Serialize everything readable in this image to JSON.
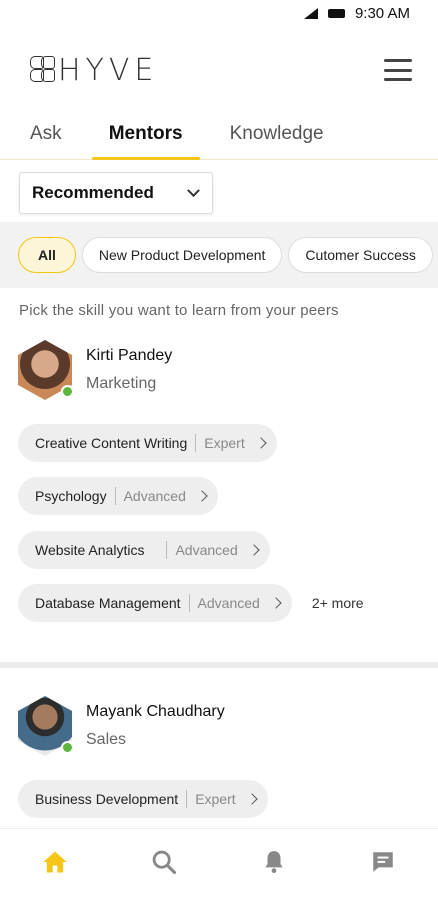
{
  "status": {
    "time": "9:30 AM"
  },
  "app": {
    "logo_text": "HYVE"
  },
  "tabs": [
    {
      "label": "Ask",
      "active": false
    },
    {
      "label": "Mentors",
      "active": true
    },
    {
      "label": "Knowledge",
      "active": false
    }
  ],
  "filter": {
    "selected": "Recommended"
  },
  "chips": [
    {
      "label": "All",
      "active": true
    },
    {
      "label": "New Product Development",
      "active": false
    },
    {
      "label": "Cutomer Success",
      "active": false
    }
  ],
  "hint": "Pick the skill you want to learn from your peers",
  "mentors": [
    {
      "name": "Kirti Pandey",
      "department": "Marketing",
      "online": true,
      "skills": [
        {
          "name": "Creative Content Writing",
          "level": "Expert"
        },
        {
          "name": "Psychology",
          "level": "Advanced"
        },
        {
          "name": "Website Analytics",
          "level": "Advanced"
        },
        {
          "name": "Database Management",
          "level": "Advanced"
        }
      ],
      "more": "2+ more"
    },
    {
      "name": "Mayank Chaudhary",
      "department": "Sales",
      "online": true,
      "skills": [
        {
          "name": "Business Development",
          "level": "Expert"
        }
      ]
    }
  ],
  "bottom_nav": [
    {
      "icon": "home-icon",
      "active": true
    },
    {
      "icon": "search-icon",
      "active": false
    },
    {
      "icon": "bell-icon",
      "active": false
    },
    {
      "icon": "chat-icon",
      "active": false
    }
  ],
  "colors": {
    "accent": "#f5c518",
    "online": "#5cb83a",
    "chip_bg": "#eeeeee"
  }
}
